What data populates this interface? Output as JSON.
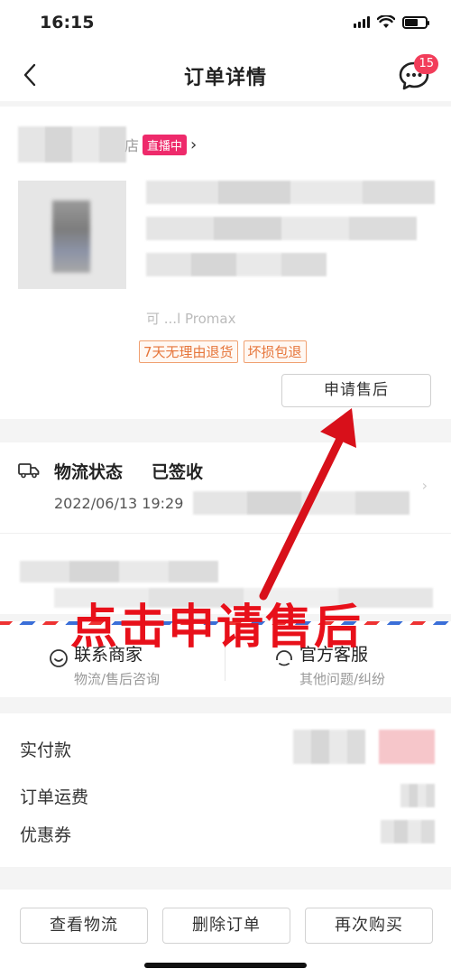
{
  "status_bar": {
    "time": "16:15"
  },
  "nav": {
    "title": "订单详情",
    "badge_count": "15"
  },
  "shop": {
    "name_tail": "店",
    "live_tag": "直播中"
  },
  "product": {
    "spec_text": "可         ...l Promax",
    "service_tags": [
      "7天无理由退货",
      "坏损包退"
    ],
    "after_sale_button": "申请售后"
  },
  "logistics": {
    "label": "物流状态",
    "status": "已签收",
    "time": "2022/06/13 19:29"
  },
  "contact": {
    "merchant_title": "联系商家",
    "merchant_sub": "物流/售后咨询",
    "service_title": "官方客服",
    "service_sub": "其他问题/纠纷"
  },
  "annotation": {
    "text": "点击申请售后",
    "color": "#e8101a"
  },
  "payment": {
    "paid_label": "实付款",
    "shipping_label": "订单运费",
    "coupon_label": "优惠券"
  },
  "actions": {
    "track": "查看物流",
    "delete": "删除订单",
    "rebuy": "再次购买"
  },
  "colors": {
    "live": "#ee2a6b",
    "badge": "#f23d5a",
    "tag": "#e6753a"
  }
}
